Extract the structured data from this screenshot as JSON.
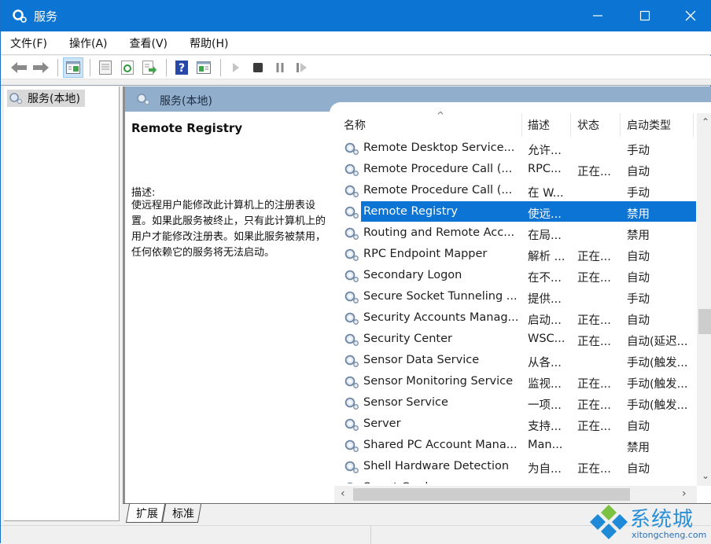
{
  "window": {
    "title": "服务",
    "accent_color": "#0c74d2",
    "controls": {
      "minimize": "minimize-icon",
      "maximize": "maximize-icon",
      "close": "close-icon"
    }
  },
  "menubar": {
    "items": [
      {
        "label": "文件(F)"
      },
      {
        "label": "操作(A)"
      },
      {
        "label": "查看(V)"
      },
      {
        "label": "帮助(H)"
      }
    ]
  },
  "toolbar": {
    "buttons": [
      {
        "icon": "back-arrow-icon",
        "tooltip": ""
      },
      {
        "icon": "forward-arrow-icon"
      },
      {
        "icon": "show-hide-console-tree-icon",
        "active": true
      },
      {
        "icon": "properties-icon"
      },
      {
        "icon": "refresh-icon"
      },
      {
        "icon": "export-list-icon"
      },
      {
        "icon": "help-icon"
      },
      {
        "icon": "show-action-pane-icon"
      },
      {
        "icon": "start-service-icon"
      },
      {
        "icon": "stop-service-icon"
      },
      {
        "icon": "pause-service-icon"
      },
      {
        "icon": "resume-service-icon"
      }
    ]
  },
  "tree": {
    "items": [
      {
        "label": "服务(本地)",
        "selected": true
      }
    ]
  },
  "pane": {
    "header_title": "服务(本地)",
    "description": {
      "service_name": "Remote Registry",
      "label": "描述:",
      "text": "使远程用户能修改此计算机上的注册表设置。如果此服务被终止，只有此计算机上的用户才能修改注册表。如果此服务被禁用，任何依赖它的服务将无法启动。"
    },
    "columns": [
      {
        "label": "名称",
        "sorted": "ascending"
      },
      {
        "label": "描述"
      },
      {
        "label": "状态"
      },
      {
        "label": "启动类型"
      }
    ],
    "rows": [
      {
        "name": "Remote Desktop Service...",
        "desc": "允许...",
        "status": "",
        "startup": "手动"
      },
      {
        "name": "Remote Procedure Call (...",
        "desc": "RPC...",
        "status": "正在...",
        "startup": "自动"
      },
      {
        "name": "Remote Procedure Call (...",
        "desc": "在 W...",
        "status": "",
        "startup": "手动"
      },
      {
        "name": "Remote Registry",
        "desc": "使远...",
        "status": "",
        "startup": "禁用",
        "selected": true
      },
      {
        "name": "Routing and Remote Acc...",
        "desc": "在局...",
        "status": "",
        "startup": "禁用"
      },
      {
        "name": "RPC Endpoint Mapper",
        "desc": "解析 ...",
        "status": "正在...",
        "startup": "自动"
      },
      {
        "name": "Secondary Logon",
        "desc": "在不...",
        "status": "正在...",
        "startup": "自动"
      },
      {
        "name": "Secure Socket Tunneling ...",
        "desc": "提供...",
        "status": "",
        "startup": "手动"
      },
      {
        "name": "Security Accounts Manag...",
        "desc": "启动...",
        "status": "正在...",
        "startup": "自动"
      },
      {
        "name": "Security Center",
        "desc": "WSC...",
        "status": "正在...",
        "startup": "自动(延迟..."
      },
      {
        "name": "Sensor Data Service",
        "desc": "从各...",
        "status": "",
        "startup": "手动(触发..."
      },
      {
        "name": "Sensor Monitoring Service",
        "desc": "监视...",
        "status": "正在...",
        "startup": "手动(触发..."
      },
      {
        "name": "Sensor Service",
        "desc": "一项...",
        "status": "正在...",
        "startup": "手动(触发..."
      },
      {
        "name": "Server",
        "desc": "支持...",
        "status": "正在...",
        "startup": "自动"
      },
      {
        "name": "Shared PC Account Mana...",
        "desc": "Man...",
        "status": "",
        "startup": "禁用"
      },
      {
        "name": "Shell Hardware Detection",
        "desc": "为自...",
        "status": "正在...",
        "startup": "自动"
      },
      {
        "name": "Smart Card",
        "desc": "管理...",
        "status": "",
        "startup": "禁用"
      }
    ],
    "selection_color": "#0b74d4",
    "vertical_scroll_position": 0.55
  },
  "tabs": [
    {
      "label": "扩展",
      "active": true
    },
    {
      "label": "标准",
      "active": false
    }
  ],
  "watermark": {
    "text": "系统城",
    "url": "xitongcheng.com"
  }
}
